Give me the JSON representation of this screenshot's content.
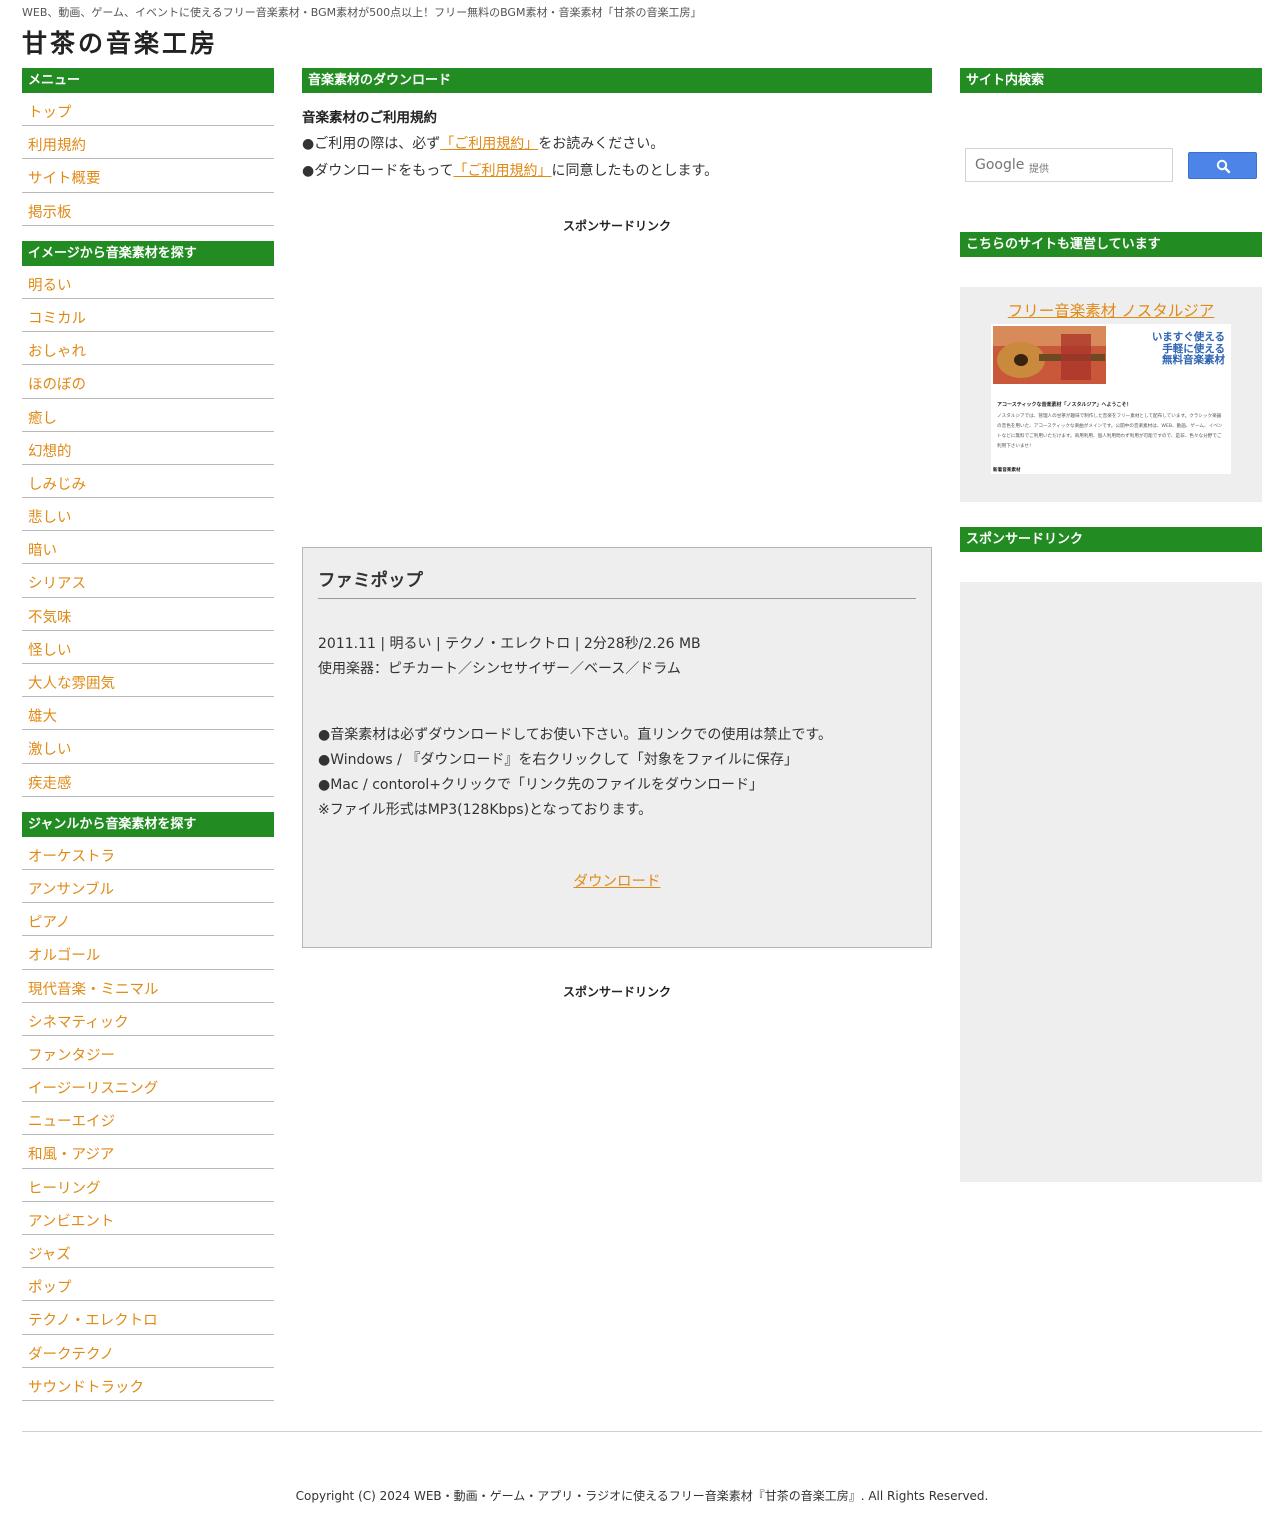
{
  "header": {
    "tagline": "WEB、動画、ゲーム、イベントに使えるフリー音楽素材・BGM素材が500点以上！フリー無料のBGM素材・音楽素材「甘茶の音楽工房」",
    "site_title": "甘茶の音楽工房"
  },
  "left_sidebar": {
    "menu_heading": "メニュー",
    "menu_items": [
      "トップ",
      "利用規約",
      "サイト概要",
      "掲示板"
    ],
    "image_heading": "イメージから音楽素材を探す",
    "image_items": [
      "明るい",
      "コミカル",
      "おしゃれ",
      "ほのぼの",
      "癒し",
      "幻想的",
      "しみじみ",
      "悲しい",
      "暗い",
      "シリアス",
      "不気味",
      "怪しい",
      "大人な雰囲気",
      "雄大",
      "激しい",
      "疾走感"
    ],
    "genre_heading": "ジャンルから音楽素材を探す",
    "genre_items": [
      "オーケストラ",
      "アンサンブル",
      "ピアノ",
      "オルゴール",
      "現代音楽・ミニマル",
      "シネマティック",
      "ファンタジー",
      "イージーリスニング",
      "ニューエイジ",
      "和風・アジア",
      "ヒーリング",
      "アンビエント",
      "ジャズ",
      "ポップ",
      "テクノ・エレクトロ",
      "ダークテクノ",
      "サウンドトラック"
    ]
  },
  "main": {
    "heading": "音楽素材のダウンロード",
    "terms_title": "音楽素材のご利用規約",
    "terms_line1_prefix": "●ご利用の際は、必ず",
    "terms_link": "「ご利用規約」",
    "terms_line1_suffix": "をお読みください。",
    "terms_line2_prefix": "●ダウンロードをもって",
    "terms_line2_suffix": "に同意したものとします。",
    "sponsor_label": "スポンサードリンク",
    "track": {
      "title": "ファミポップ",
      "meta": "2011.11 | 明るい | テクノ・エレクトロ | 2分28秒/2.26 MB",
      "instruments": "使用楽器：ピチカート／シンセサイザー／ベース／ドラム",
      "notes": [
        "●音楽素材は必ずダウンロードしてお使い下さい。直リンクでの使用は禁止です。",
        "●Windows / 『ダウンロード』を右クリックして「対象をファイルに保存」",
        "●Mac / contorol+クリックで「リンク先のファイルをダウンロード」",
        "※ファイル形式はMP3(128Kbps)となっております。"
      ],
      "download_label": "ダウンロード"
    }
  },
  "right_sidebar": {
    "search_heading": "サイト内検索",
    "search_brand": "Google",
    "search_brand_sub": "提供",
    "sites_heading": "こちらのサイトも運営しています",
    "promo_link": "フリー音楽素材 ノスタルジア",
    "promo_image": {
      "slogan": [
        "いますぐ使える",
        "手軽に使える",
        "無料音楽素材"
      ],
      "welcome": "アコースティックな音楽素材「ノスタルジア」へようこそ！",
      "body": "ノスタルジアでは、管理人の甘茶が趣味で制作した音楽をフリー素材として配布しています。クラシック楽器の音色を用いた、アコースティックな楽曲がメインです。公開中の音楽素材は、WEB、動画、ゲーム、イベントなどに無料でご利用いただけます。商用利用、個人利用問わず利用が可能ですので、是非、色々な分野でご利用下さいませ！",
      "new_label": "新着音楽素材"
    },
    "sponsor_heading": "スポンサードリンク"
  },
  "footer": {
    "copyright": "Copyright (C) 2024 WEB・動画・ゲーム・アプリ・ラジオに使えるフリー音楽素材『甘茶の音楽工房』. All Rights Reserved."
  },
  "colors": {
    "heading_bg": "#228b22",
    "link": "#e08a16",
    "panel_bg": "#eeeeee",
    "search_button": "#4d84e8"
  }
}
